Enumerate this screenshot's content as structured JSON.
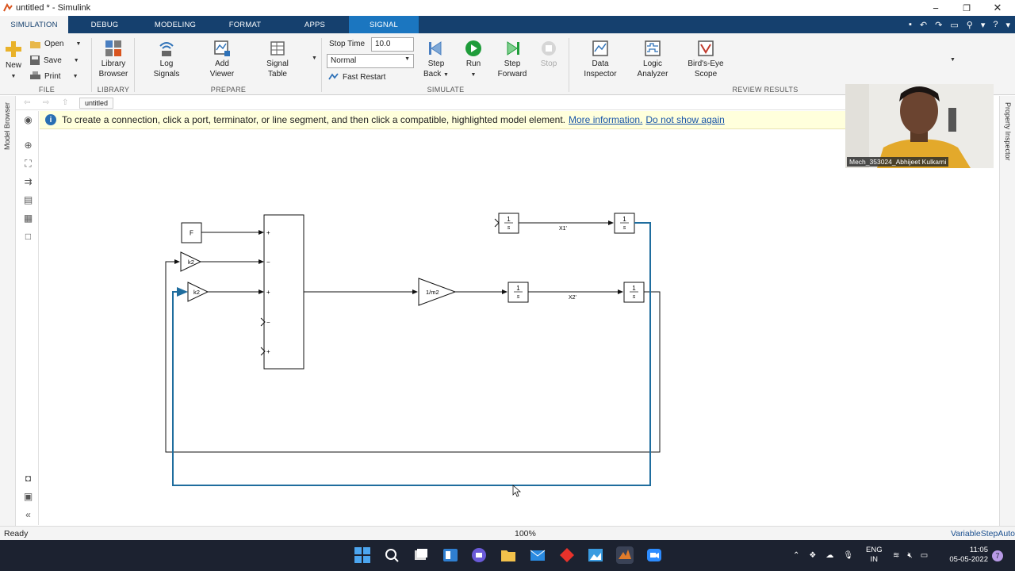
{
  "window": {
    "title": "untitled * - Simulink",
    "minimize": "−",
    "restore": "❐",
    "close": "✕"
  },
  "tabs": [
    "SIMULATION",
    "DEBUG",
    "MODELING",
    "FORMAT",
    "APPS",
    "SIGNAL"
  ],
  "ribbon": {
    "file": {
      "new_label": "New",
      "open_label": "Open",
      "save_label": "Save",
      "print_label": "Print",
      "section": "FILE"
    },
    "library": {
      "browser_label_1": "Library",
      "browser_label_2": "Browser",
      "section": "LIBRARY"
    },
    "prepare": {
      "log_1": "Log",
      "log_2": "Signals",
      "add_1": "Add",
      "add_2": "Viewer",
      "table_1": "Signal",
      "table_2": "Table",
      "section": "PREPARE"
    },
    "simulate": {
      "stop_time_label": "Stop Time",
      "stop_time_value": "10.0",
      "mode_value": "Normal",
      "fast_restart_label": "Fast Restart",
      "step_back_1": "Step",
      "step_back_2": "Back",
      "run_label": "Run",
      "step_fwd_1": "Step",
      "step_fwd_2": "Forward",
      "stop_label": "Stop",
      "section": "SIMULATE"
    },
    "review": {
      "data_1": "Data",
      "data_2": "Inspector",
      "logic_1": "Logic",
      "logic_2": "Analyzer",
      "birds_1": "Bird's-Eye",
      "birds_2": "Scope",
      "section": "REVIEW RESULTS"
    }
  },
  "breadcrumb": "untitled",
  "left_panel_label": "Model Browser",
  "right_panel_label": "Property Inspector",
  "banner": {
    "text": "To create a connection, click a port, terminator, or line segment, and then click a compatible, highlighted model element.",
    "link1": "More information.",
    "link2": "Do not show again"
  },
  "diagram": {
    "const_label": "F",
    "gain1_label": "k2",
    "gain2_label": "k2",
    "gain3_label": "1/m2",
    "integ_num": "1",
    "integ_den": "s",
    "signal1": "X1'",
    "signal2": "X2'",
    "sum_signs": [
      "+",
      "−",
      "+",
      "−",
      "+"
    ]
  },
  "webcam": {
    "name": "Mech_353024_Abhijeet Kulkarni"
  },
  "status": {
    "left": "Ready",
    "zoom": "100%",
    "solver": "VariableStepAuto"
  },
  "taskbar": {
    "lang_1": "ENG",
    "lang_2": "IN",
    "time": "11:05",
    "date": "05-05-2022",
    "badge": "7"
  },
  "colors": {
    "tabstrip": "#15406e",
    "signal_tab": "#1b76c0",
    "selected_line": "#1f6d9e",
    "banner": "#ffffdc"
  }
}
